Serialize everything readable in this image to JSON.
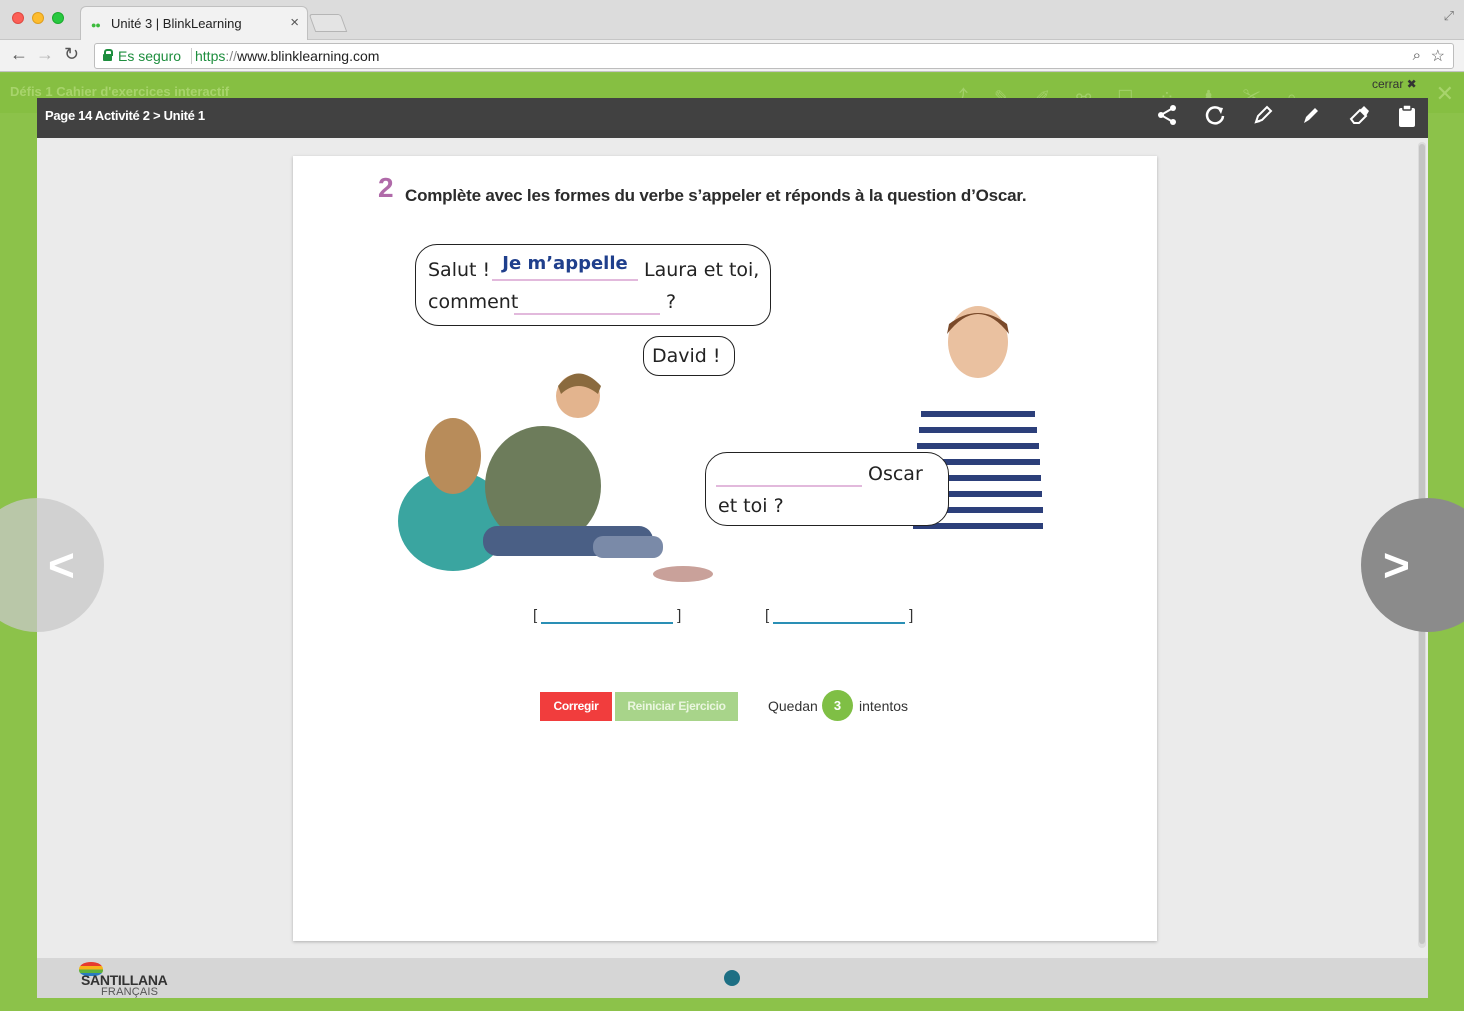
{
  "browser": {
    "tab_title": "Unité 3 | BlinkLearning",
    "tab_close": "×",
    "secure_label": "Es seguro",
    "url_scheme": "https",
    "url_slashes": "://",
    "url_host": "www.blinklearning.com"
  },
  "app": {
    "title": "Défis 1 Cahier d'exercices interactif",
    "close_label": "cerrar ✖"
  },
  "viewer": {
    "breadcrumb": "Page 14 Activité 2 > Unité 1",
    "tools": [
      "share-icon",
      "reload-icon",
      "pencil-icon",
      "marker-icon",
      "eraser-icon",
      "clipboard-icon"
    ]
  },
  "exercise": {
    "number": "2",
    "instruction": "Complète avec les formes du verbe s’appeler et réponds à la question d’Oscar.",
    "bubble1": {
      "line1_start": "Salut !",
      "answer1": "Je m’appelle",
      "line1_end": "Laura et toi,",
      "line2_start": "comment",
      "line2_end": "?"
    },
    "bubble2": {
      "text": "David !"
    },
    "bubble3": {
      "line1_end": "Oscar",
      "line2": "et toi ?"
    },
    "answer_fields": [
      {
        "open": "[",
        "value": "",
        "close": "]"
      },
      {
        "open": "[",
        "value": "",
        "close": "]"
      }
    ],
    "buttons": {
      "check": "Corregir",
      "reset": "Reiniciar Ejercicio"
    },
    "attempts": {
      "prefix": "Quedan",
      "count": "3",
      "suffix": "intentos"
    }
  },
  "footer": {
    "logo_text": "SANTILLANA",
    "logo_sub": "FRANÇAIS"
  },
  "colors": {
    "accent_green": "#8cc24a",
    "check_red": "#f13d3d",
    "reset_green": "#a8d48a",
    "title_purple": "#b06aa9",
    "answer_blue": "#1f3f8c"
  }
}
